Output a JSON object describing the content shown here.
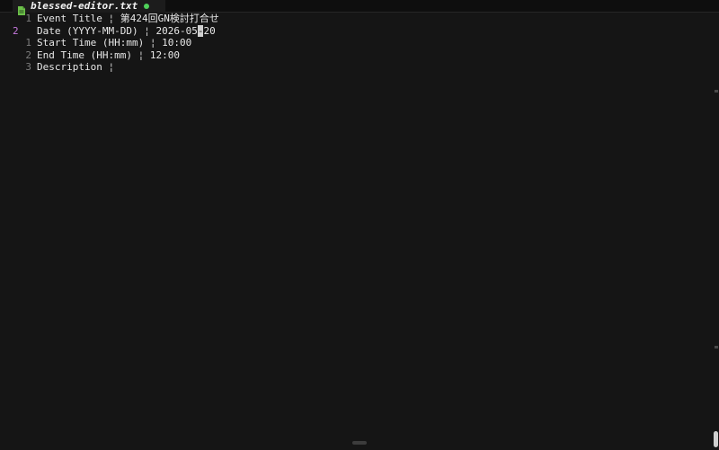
{
  "tab": {
    "title": "blessed-editor.txt",
    "file_icon": "file-icon",
    "modified_indicator": "modified-dot-icon"
  },
  "editor": {
    "lines": [
      {
        "number": "1",
        "label": "Event Title",
        "separator": "¦",
        "value": "第424回GN検討打合せ",
        "active": false
      },
      {
        "number": "2",
        "label": "Date (YYYY-MM-DD)",
        "separator": "¦",
        "value_before_cursor": "2026-05",
        "cursor_char": "-",
        "value_after_cursor": "20",
        "active": true
      },
      {
        "number": "1",
        "label": "Start Time (HH:mm)",
        "separator": "¦",
        "value": "10:00",
        "active": false
      },
      {
        "number": "2",
        "label": "End Time (HH:mm)",
        "separator": "¦",
        "value": "12:00",
        "active": false
      },
      {
        "number": "3",
        "label": "Description",
        "separator": "¦",
        "value": "",
        "active": false
      }
    ]
  },
  "colors": {
    "background": "#151515",
    "text": "#e8e8e8",
    "line_number": "#7c7c7c",
    "active_line_number": "#c678dd",
    "cursor": "#d0d0d0",
    "file_icon": "#6cc04a",
    "modified_dot": "#4fd15a"
  }
}
